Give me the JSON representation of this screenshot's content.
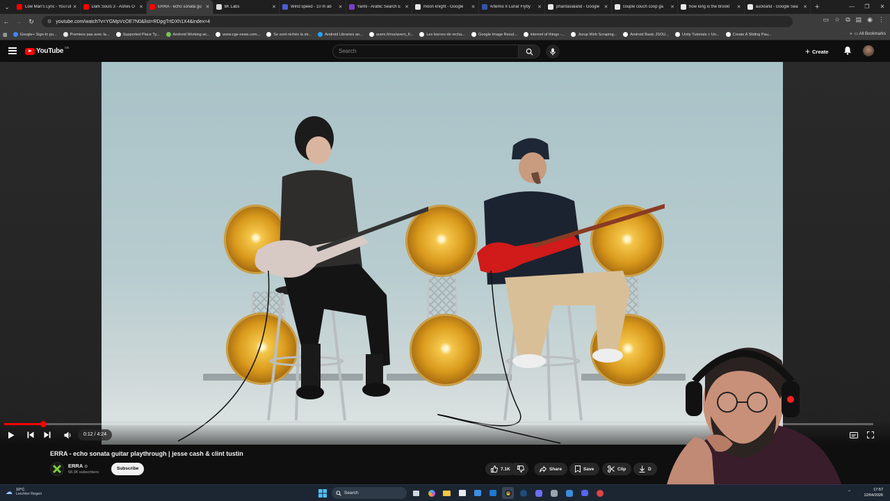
{
  "browser": {
    "tabs": [
      {
        "title": "Low Man's Lyric - YouTube",
        "color": "#ff0000",
        "active": false
      },
      {
        "title": "Dark Souls 3 - Ashes O",
        "color": "#ff0000",
        "active": false
      },
      {
        "title": "ERRA - echo sonata gu",
        "color": "#ff0000",
        "active": true
      },
      {
        "title": "6K Labs",
        "color": "#dddddd",
        "active": false
      },
      {
        "title": "Wind speed - 10 m ab",
        "color": "#4a5bd6",
        "active": false
      },
      {
        "title": "Yamli - Arabic Search E",
        "color": "#7b3fc7",
        "active": false
      },
      {
        "title": "moon knight - Google",
        "color": "#e8e8e8",
        "active": false
      },
      {
        "title": "Artemis II Lunar Flyby",
        "color": "#3355aa",
        "active": false
      },
      {
        "title": "phantasialand - Google",
        "color": "#e8e8e8",
        "active": false
      },
      {
        "title": "couple couch coop ga",
        "color": "#e8e8e8",
        "active": false
      },
      {
        "title": "how long is the brookl",
        "color": "#e8e8e8",
        "active": false
      },
      {
        "title": "auckland - Google Sea",
        "color": "#e8e8e8",
        "active": false
      }
    ],
    "url": "youtube.com/watch?v=YGMpVcOE7N0&list=RDpgTrtDXh1X4&index=4",
    "bookmarks": [
      {
        "label": "Google+ Sign-In po...",
        "color": "#4285f4"
      },
      {
        "label": "Premiers pas avec la...",
        "color": "#e9e9e9"
      },
      {
        "label": "Supported Place Ty...",
        "color": "#ffffff"
      },
      {
        "label": "Android Working wi...",
        "color": "#78c257"
      },
      {
        "label": "www.cge-news.com...",
        "color": "#ffffff"
      },
      {
        "label": "Se sont nichés la str...",
        "color": "#ffffff"
      },
      {
        "label": "Android Libraries an...",
        "color": "#2aa4f4"
      },
      {
        "label": "avem.fr/rss/avem_fl...",
        "color": "#ffffff"
      },
      {
        "label": "Les bornes de recha...",
        "color": "#ffffff"
      },
      {
        "label": "Google Image Resul...",
        "color": "#ffffff"
      },
      {
        "label": "internet of things -...",
        "color": "#ffffff"
      },
      {
        "label": "Jsoup Web Scraping...",
        "color": "#ffffff"
      },
      {
        "label": "Android Basic JSOU...",
        "color": "#ffffff"
      },
      {
        "label": "Unity Tutorials > Un...",
        "color": "#ffffff"
      },
      {
        "label": "Create A Sliding Pau...",
        "color": "#ffffff"
      }
    ],
    "all_bookmarks": "All Bookmarks"
  },
  "youtube": {
    "logo_text": "YouTube",
    "country_code": "DE",
    "search_placeholder": "Search",
    "create_label": "Create"
  },
  "player": {
    "current_time": "0:12",
    "duration": "4:24",
    "time_display": "0:12 / 4:24",
    "progress_fraction": 0.045
  },
  "video": {
    "title": "ERRA - echo sonata guitar playthrough | jesse cash & clint tustin",
    "channel": "ERRA",
    "subscribers": "58.3K subscribers",
    "subscribe_label": "Subscribe",
    "likes": "7.1K",
    "share_label": "Share",
    "save_label": "Save",
    "clip_label": "Clip",
    "download_label": "D"
  },
  "taskbar": {
    "temperature": "10°C",
    "weather_text": "Leichter Regen",
    "search_label": "Search",
    "time": "17:57",
    "date": "12/04/2026"
  },
  "colors": {
    "accent_red": "#ff0000",
    "background": "#0f0f0f"
  }
}
